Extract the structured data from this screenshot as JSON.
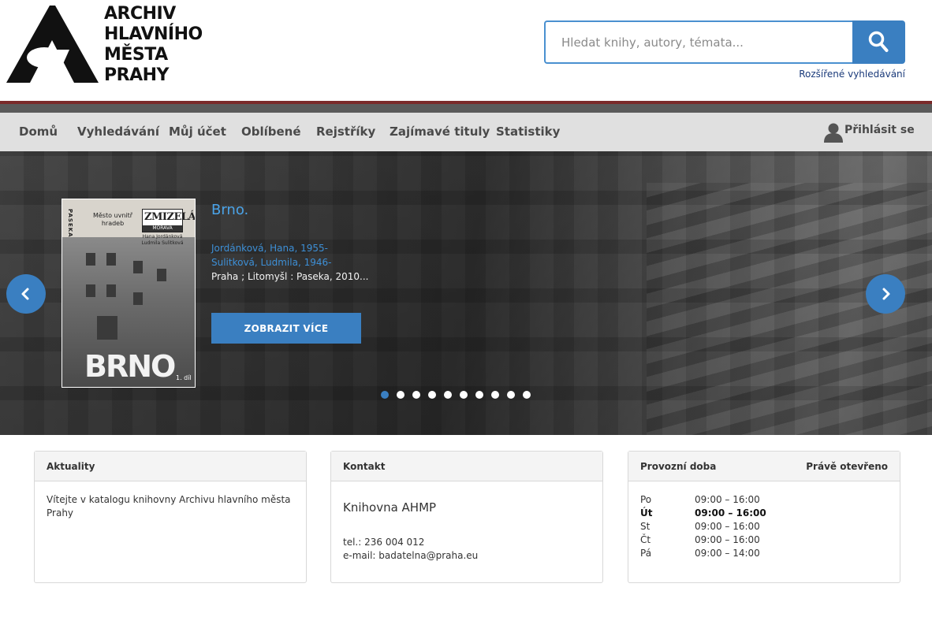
{
  "header": {
    "logo_lines": [
      "ARCHIV",
      "HLAVNÍHO",
      "MĚSTA",
      "PRAHY"
    ],
    "search_placeholder": "Hledat knihy, autory, témata...",
    "search_icon": "magnifier-icon",
    "advanced_search": "Rozšířené vyhledávání"
  },
  "nav": {
    "items": [
      "Domů",
      "Vyhledávání",
      "Můj účet",
      "Oblíbené",
      "Rejstříky",
      "Zajímavé tituly",
      "Statistiky"
    ],
    "login": "Přihlásit se",
    "login_icon": "user-icon"
  },
  "carousel": {
    "cover": {
      "publisher": "PASEKA",
      "subtitle": "Město uvnitř hradeb",
      "series_top": "ZMIZELÁ",
      "series_bottom": "MORAVA",
      "authors": "Hana Jordánková Ludmila Sulitková",
      "title": "BRNO",
      "volume": "1. díl"
    },
    "title": "Brno.",
    "authors": [
      "Jordánková, Hana, 1955-",
      "Sulitková, Ludmila, 1946-"
    ],
    "imprint": "Praha ; Litomyšl : Paseka, 2010...",
    "button": "ZOBRAZIT VÍCE",
    "slide_count": 10,
    "active_slide": 1,
    "prev_icon": "chevron-left-icon",
    "next_icon": "chevron-right-icon"
  },
  "panels": {
    "news": {
      "title": "Aktuality",
      "text": "Vítejte v katalogu knihovny Archivu hlavního města Prahy"
    },
    "contact": {
      "title": "Kontakt",
      "name": "Knihovna AHMP",
      "phone": "tel.: 236 004 012",
      "email": "e-mail: badatelna@praha.eu"
    },
    "hours": {
      "title": "Provozní doba",
      "status": "Právě otevřeno",
      "rows": [
        {
          "day": "Po",
          "time": "09:00 – 16:00"
        },
        {
          "day": "Út",
          "time": "09:00 – 16:00"
        },
        {
          "day": "St",
          "time": "09:00 – 16:00"
        },
        {
          "day": "Čt",
          "time": "09:00 – 16:00"
        },
        {
          "day": "Pá",
          "time": "09:00 – 14:00"
        }
      ],
      "today": "Út"
    }
  },
  "colors": {
    "accent": "#3a7fc1",
    "link": "#4aa3e8",
    "nav_bg": "#e0e0e0",
    "rule": "#7a2a2a"
  }
}
